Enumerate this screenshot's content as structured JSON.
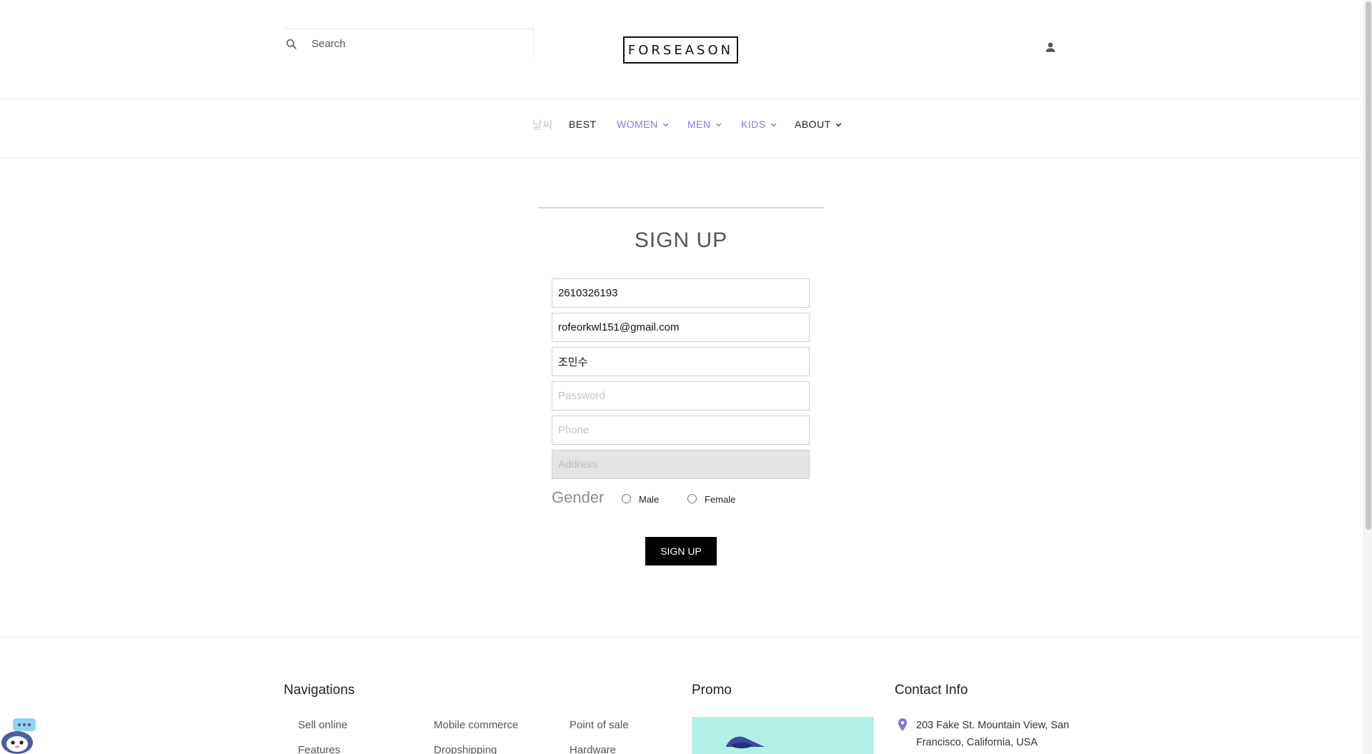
{
  "header": {
    "search_placeholder": "Search",
    "logo_text": "FORSEASON"
  },
  "nav": {
    "items": [
      {
        "label": "날씨",
        "has_dropdown": false,
        "color": "#c8c8c8"
      },
      {
        "label": "BEST",
        "has_dropdown": false,
        "color": "#222222"
      },
      {
        "label": "WOMEN",
        "has_dropdown": true,
        "color": "#8d73e0"
      },
      {
        "label": "MEN",
        "has_dropdown": true,
        "color": "#8d73e0"
      },
      {
        "label": "KIDS",
        "has_dropdown": true,
        "color": "#8d73e0"
      },
      {
        "label": "ABOUT",
        "has_dropdown": true,
        "color": "#222222"
      }
    ]
  },
  "signup": {
    "title": "SIGN UP",
    "fields": {
      "id_value": "2610326193",
      "email_value": "rofeorkwl151@gmail.com",
      "name_value": "조민수",
      "password_placeholder": "Password",
      "phone_placeholder": "Phone",
      "address_placeholder": "Address"
    },
    "gender_label": "Gender",
    "gender_options": [
      "Male",
      "Female"
    ],
    "submit_label": "SIGN UP"
  },
  "footer": {
    "navigations_title": "Navigations",
    "links_col1": [
      "Sell online",
      "Features"
    ],
    "links_col2": [
      "Mobile commerce",
      "Dropshipping"
    ],
    "links_col3": [
      "Point of sale",
      "Hardware"
    ],
    "promo_title": "Promo",
    "contact_title": "Contact Info",
    "address": "203 Fake St. Mountain View, San Francisco, California, USA"
  },
  "colors": {
    "accent": "#8d73e0",
    "button_bg": "#000000",
    "promo_bg": "#b3f0e8"
  }
}
